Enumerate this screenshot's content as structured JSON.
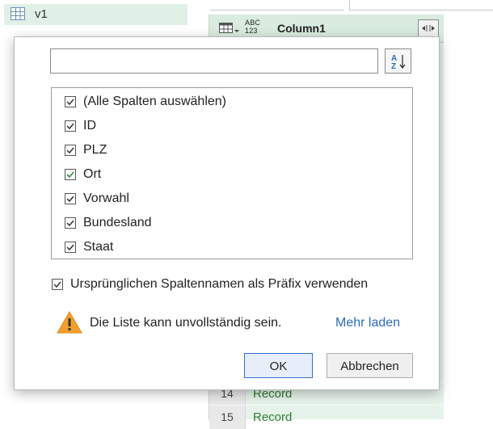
{
  "queries": [
    {
      "name": "v1"
    }
  ],
  "grid": {
    "column_type_badge": [
      "ABC",
      "123"
    ],
    "column_name": "Column1",
    "expand_glyph": "⇤⇥",
    "rows": [
      {
        "num": "14",
        "value": "Record"
      },
      {
        "num": "15",
        "value": "Record"
      }
    ]
  },
  "dialog": {
    "search": {
      "value": "",
      "placeholder": ""
    },
    "columns": [
      {
        "label": "(Alle Spalten auswählen)",
        "checked": true
      },
      {
        "label": "ID",
        "checked": true
      },
      {
        "label": "PLZ",
        "checked": true
      },
      {
        "label": "Ort",
        "checked": true,
        "highlight": true
      },
      {
        "label": "Vorwahl",
        "checked": true
      },
      {
        "label": "Bundesland",
        "checked": true
      },
      {
        "label": "Staat",
        "checked": true
      }
    ],
    "prefix_label": "Ursprünglichen Spaltennamen als Präfix verwenden",
    "prefix_checked": true,
    "warning_text": "Die Liste kann unvollständig sein.",
    "more_link": "Mehr laden",
    "ok_label": "OK",
    "cancel_label": "Abbrechen"
  },
  "colors": {
    "accent_link": "#2b6cb8",
    "grid_green": "#e6f3ea",
    "record_text": "#2e7d32",
    "warning": "#f0a030"
  },
  "icons": [
    "table-icon",
    "column-type-menu-icon",
    "expand-column-icon",
    "sort-az-icon",
    "checkbox-icon",
    "warning-icon"
  ]
}
